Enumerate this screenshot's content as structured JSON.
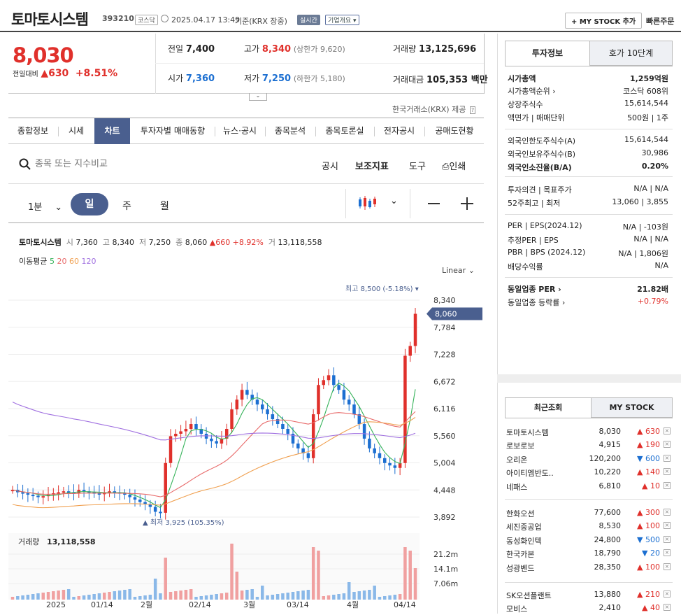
{
  "header": {
    "name": "토마토시스템",
    "code": "393210",
    "market_tag": "코스닥",
    "timestamp": "2025.04.17 13:49",
    "basis": "기준(KRX 장중)",
    "realtime": "실시간",
    "company_btn": "기업개요 ▾",
    "mystock_btn": "+ MY STOCK 추가",
    "quick_order": "빠른주문"
  },
  "quote": {
    "price": "8,030",
    "change_label": "전일대비",
    "change": "▲630",
    "change_pct": "+8.51%",
    "prev_close_label": "전일",
    "prev_close": "7,400",
    "high_label": "고가",
    "high": "8,340",
    "upper_limit": "(상한가 9,620)",
    "volume_label": "거래량",
    "volume": "13,125,696",
    "open_label": "시가",
    "open": "7,360",
    "low_label": "저가",
    "low": "7,250",
    "lower_limit": "(하한가 5,180)",
    "amount_label": "거래대금",
    "amount": "105,353 백만",
    "provider": "한국거래소(KRX) 제공"
  },
  "tabs": [
    "종합정보",
    "시세",
    "차트",
    "투자자별 매매동향",
    "뉴스·공시",
    "종목분석",
    "종목토론실",
    "전자공시",
    "공매도현황"
  ],
  "toolbar": {
    "search_placeholder": "종목 또는 지수비교",
    "notice": "공시",
    "indicator": "보조지표",
    "tools": "도구",
    "print": "인쇄"
  },
  "periods": {
    "minute": "1분",
    "day": "일",
    "week": "주",
    "month": "월"
  },
  "legend": {
    "name": "토마토시스템",
    "open_l": "시",
    "open": "7,360",
    "high_l": "고",
    "high": "8,340",
    "low_l": "저",
    "low": "7,250",
    "close_l": "종",
    "close": "8,060",
    "chg": "▲660 +8.92%",
    "vol_l": "거",
    "vol": "13,118,558",
    "ma_label": "이동평균",
    "ma5": "5",
    "ma20": "20",
    "ma60": "60",
    "ma120": "120",
    "scale": "Linear"
  },
  "chart_data": {
    "type": "candlestick",
    "price_ticks": [
      "8,340",
      "7,784",
      "7,228",
      "6,672",
      "6,116",
      "5,560",
      "5,004",
      "4,448",
      "3,892"
    ],
    "current_price": "8,060",
    "high_note": "최고 8,500 (-5.18%)",
    "low_note": "▲ 최저 3,925 (105.35%)",
    "volume_label": "거래량",
    "volume_value": "13,118,558",
    "volume_ticks": [
      "21.2m",
      "14.1m",
      "7.06m"
    ],
    "x_labels": [
      "2025",
      "01/14",
      "2월",
      "02/14",
      "3월",
      "03/14",
      "4월",
      "04/14"
    ],
    "colors": {
      "up": "#e0302b",
      "down": "#1c6fd1",
      "ma5": "#36b35a",
      "ma20": "#e86a6a",
      "ma60": "#f0a050",
      "ma120": "#a070e0"
    }
  },
  "invest": {
    "tab1": "투자정보",
    "tab2": "호가 10단계",
    "rows": [
      {
        "l": "시가총액",
        "v": "1,259억원",
        "bold": true
      },
      {
        "l": "시가총액순위 ›",
        "v": "코스닥 608위"
      },
      {
        "l": "상장주식수",
        "v": "15,614,544"
      },
      {
        "l": "액면가 | 매매단위",
        "v": "500원 | 1주"
      },
      {
        "l": "외국인한도주식수(A)",
        "v": "15,614,544"
      },
      {
        "l": "외국인보유주식수(B)",
        "v": "30,986"
      },
      {
        "l": "외국인소진율(B/A)",
        "v": "0.20%",
        "bold": true
      },
      {
        "l": "투자의견 | 목표주가",
        "v": "N/A | N/A"
      },
      {
        "l": "52주최고 | 최저",
        "v": "13,060 | 3,855"
      },
      {
        "l": "PER | EPS(2024.12)",
        "v": "N/A | -103원"
      },
      {
        "l": "추정PER | EPS",
        "v": "N/A | N/A"
      },
      {
        "l": "PBR | BPS (2024.12)",
        "v": "N/A | 1,806원"
      },
      {
        "l": "배당수익률",
        "v": "N/A"
      },
      {
        "l": "동일업종 PER ›",
        "v": "21.82배",
        "bold": true
      },
      {
        "l": "동일업종 등락률 ›",
        "v": "+0.79%",
        "red": true
      }
    ]
  },
  "recent": {
    "tab1": "최근조회",
    "tab2": "MY STOCK",
    "items": [
      {
        "n": "토마토시스템",
        "p": "8,030",
        "c": "▲ 630",
        "up": true
      },
      {
        "n": "로보로보",
        "p": "4,915",
        "c": "▲ 190",
        "up": true
      },
      {
        "n": "오리온",
        "p": "120,200",
        "c": "▼ 600",
        "up": false
      },
      {
        "n": "아이티엠반도..",
        "p": "10,220",
        "c": "▲ 140",
        "up": true
      },
      {
        "n": "네패스",
        "p": "6,810",
        "c": "▲ 10",
        "up": true
      },
      {
        "n": "한화오션",
        "p": "77,600",
        "c": "▲ 300",
        "up": true
      },
      {
        "n": "세진중공업",
        "p": "8,530",
        "c": "▲ 100",
        "up": true
      },
      {
        "n": "동성화인텍",
        "p": "24,800",
        "c": "▼ 500",
        "up": false
      },
      {
        "n": "한국카본",
        "p": "18,790",
        "c": "▼ 20",
        "up": false
      },
      {
        "n": "성광벤드",
        "p": "28,350",
        "c": "▲ 100",
        "up": true
      },
      {
        "n": "SK오션플랜트",
        "p": "13,880",
        "c": "▲ 210",
        "up": true
      },
      {
        "n": "모비스",
        "p": "2,410",
        "c": "▲ 40",
        "up": true
      }
    ]
  }
}
